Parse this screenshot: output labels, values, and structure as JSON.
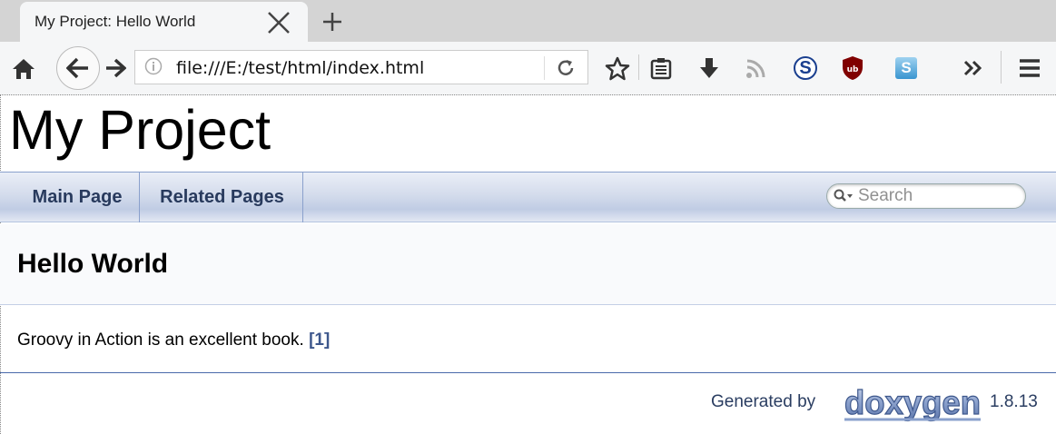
{
  "browser": {
    "tab_title": "My Project: Hello World",
    "url": "file:///E:/test/html/index.html"
  },
  "page": {
    "project_title": "My Project",
    "nav_tabs": [
      "Main Page",
      "Related Pages"
    ],
    "search_placeholder": "Search",
    "heading": "Hello World",
    "content": "Groovy in Action is an excellent book.",
    "citation": "[1]",
    "footer_generated": "Generated by",
    "footer_logo": "doxygen",
    "footer_version": "1.8.13"
  },
  "colors": {
    "nav_text": "#283a5d",
    "link": "#3d578c",
    "footer_text": "#2a3d61"
  }
}
